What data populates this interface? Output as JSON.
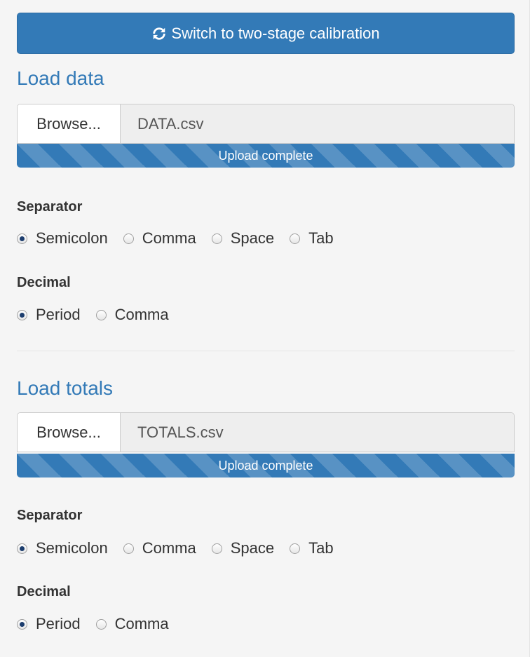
{
  "switch_button": {
    "label": "Switch to two-stage calibration",
    "icon": "refresh-icon"
  },
  "sections": [
    {
      "title": "Load data",
      "browse_label": "Browse...",
      "file_name": "DATA.csv",
      "progress_text": "Upload complete",
      "progress_fraction": 1.0,
      "separator_label": "Separator",
      "separator_options": [
        "Semicolon",
        "Comma",
        "Space",
        "Tab"
      ],
      "separator_selected": "Semicolon",
      "decimal_label": "Decimal",
      "decimal_options": [
        "Period",
        "Comma"
      ],
      "decimal_selected": "Period"
    },
    {
      "title": "Load totals",
      "browse_label": "Browse...",
      "file_name": "TOTALS.csv",
      "progress_text": "Upload complete",
      "progress_fraction": 1.0,
      "separator_label": "Separator",
      "separator_options": [
        "Semicolon",
        "Comma",
        "Space",
        "Tab"
      ],
      "separator_selected": "Semicolon",
      "decimal_label": "Decimal",
      "decimal_options": [
        "Period",
        "Comma"
      ],
      "decimal_selected": "Period"
    }
  ],
  "colors": {
    "accent": "#337ab7",
    "background": "#f5f5f5"
  }
}
